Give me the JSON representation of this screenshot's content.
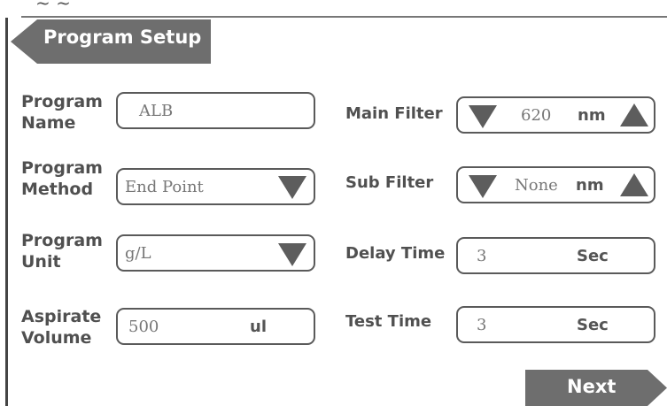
{
  "header": {
    "title": "Program Setup",
    "top_fragment": "~ ~"
  },
  "left": {
    "program_name": {
      "label1": "Program",
      "label2": "Name",
      "value": "ALB"
    },
    "program_method": {
      "label1": "Program",
      "label2": "Method",
      "value": "End Point"
    },
    "program_unit": {
      "label1": "Program",
      "label2": "Unit",
      "value": "g/L"
    },
    "aspirate_volume": {
      "label1": "Aspirate",
      "label2": "Volume",
      "value": "500",
      "unit": "ul"
    }
  },
  "right": {
    "main_filter": {
      "label": "Main Filter",
      "value": "620",
      "unit": "nm"
    },
    "sub_filter": {
      "label": "Sub Filter",
      "value": "None",
      "unit": "nm"
    },
    "delay_time": {
      "label": "Delay Time",
      "value": "3",
      "unit": "Sec"
    },
    "test_time": {
      "label": "Test Time",
      "value": "3",
      "unit": "Sec"
    }
  },
  "footer": {
    "next_label": "Next"
  },
  "colors": {
    "accent": "#6e6e6e",
    "border": "#5a5a5a",
    "label": "#505050"
  }
}
